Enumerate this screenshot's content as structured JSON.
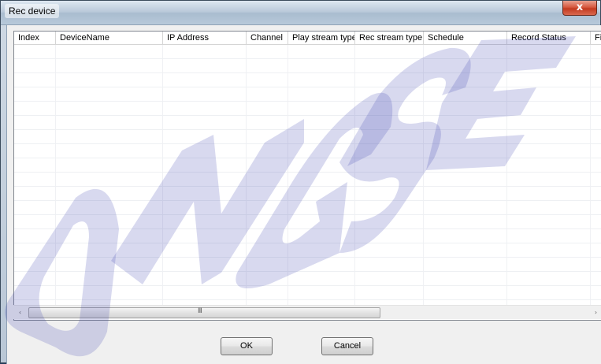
{
  "window": {
    "title": "Rec device",
    "close_glyph": "x"
  },
  "table": {
    "columns": [
      "Index",
      "DeviceName",
      "IP Address",
      "Channel",
      "Play stream type",
      "Rec stream type",
      "Schedule",
      "Record Status",
      "File"
    ],
    "empty_rows": 19
  },
  "scrollbar": {
    "left_arrow": "‹",
    "right_arrow": "›",
    "grip": "III"
  },
  "buttons": {
    "ok": "OK",
    "cancel": "Cancel"
  },
  "watermark": {
    "text": "ONGSE",
    "color": "#3a3fb0"
  },
  "colors": {
    "titlebar": "#b8c8d9",
    "close": "#c33a20",
    "dialog_bg": "#f0f0f0"
  }
}
